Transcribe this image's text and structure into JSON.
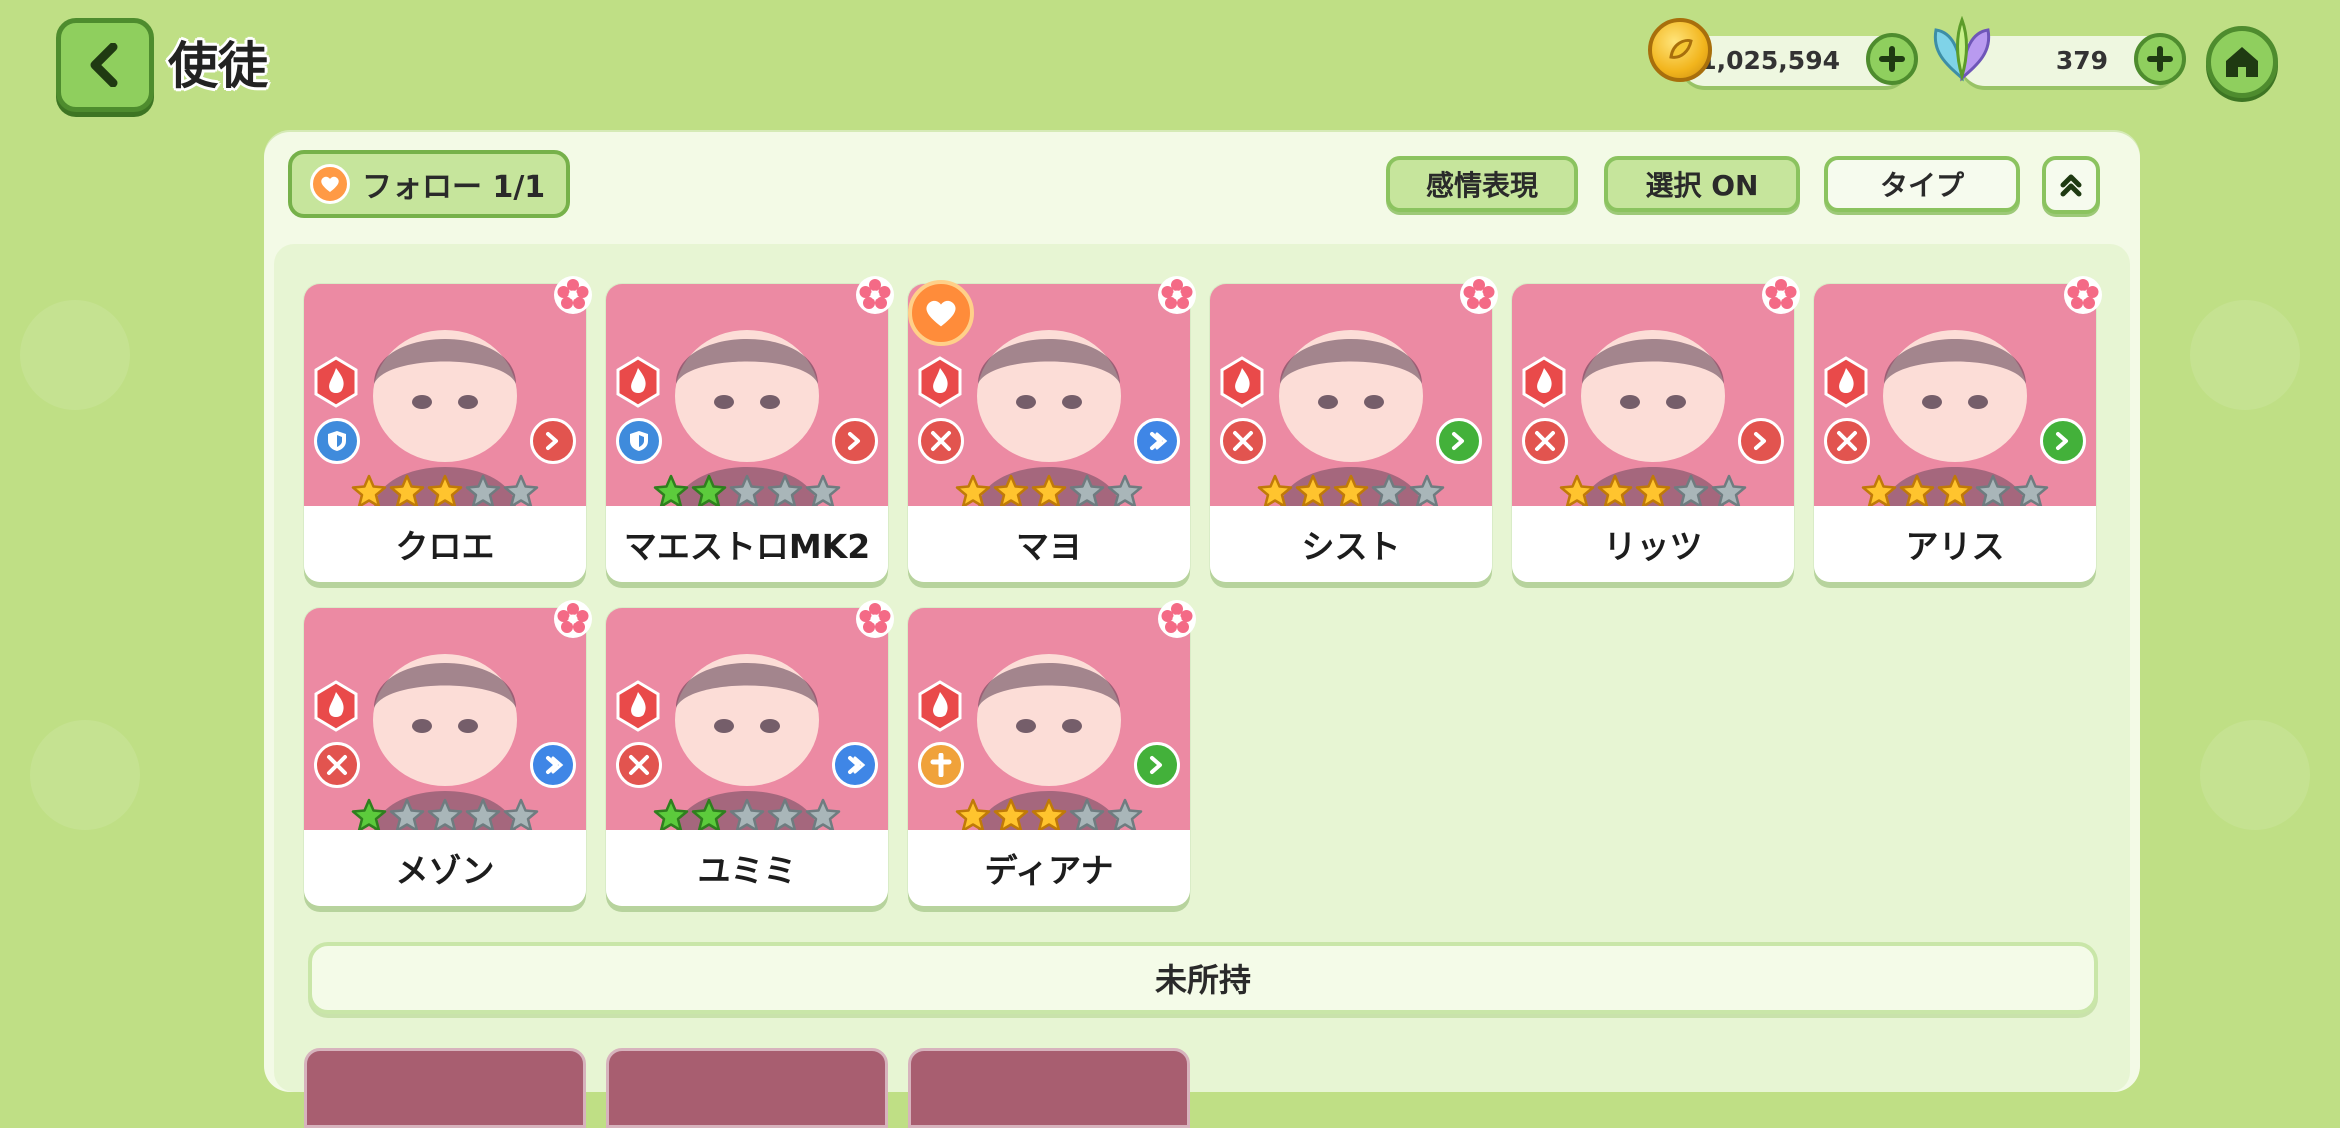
{
  "header": {
    "title": "使徒",
    "gold": "1,025,594",
    "gems": "379"
  },
  "toolbar": {
    "follow_label": "フォロー 1/1",
    "emotion_label": "感情表現",
    "select_label": "選択 ON",
    "type_label": "タイプ"
  },
  "colors": {
    "card_bg": "#ec8aa3",
    "panel_bg": "#f3fae6",
    "page_bg": "#bfdf85",
    "button_green": "#c6e59c",
    "fire_element": "#e94a4a",
    "role_defender": "#3f8bdc",
    "role_attacker": "#e2544f",
    "role_healer": "#f0a23a",
    "speed_blue": "#3f86e6",
    "speed_red": "#e2544f",
    "speed_green": "#43b13a"
  },
  "characters": [
    {
      "name": "クロエ",
      "role": "shield-icon",
      "speed": "red",
      "stars": 3,
      "star_color": "gold",
      "followed": false
    },
    {
      "name": "マエストロMK2",
      "role": "shield-icon",
      "speed": "red",
      "stars": 2,
      "star_color": "green",
      "followed": false
    },
    {
      "name": "マヨ",
      "role": "sword-icon",
      "speed": "blue",
      "stars": 3,
      "star_color": "gold",
      "followed": true
    },
    {
      "name": "シスト",
      "role": "sword-icon",
      "speed": "green",
      "stars": 3,
      "star_color": "gold",
      "followed": false
    },
    {
      "name": "リッツ",
      "role": "sword-icon",
      "speed": "red",
      "stars": 3,
      "star_color": "gold",
      "followed": false
    },
    {
      "name": "アリス",
      "role": "sword-icon",
      "speed": "green",
      "stars": 3,
      "star_color": "gold",
      "followed": false
    },
    {
      "name": "メゾン",
      "role": "sword-icon",
      "speed": "blue",
      "stars": 1,
      "star_color": "green",
      "followed": false
    },
    {
      "name": "ユミミ",
      "role": "sword-icon",
      "speed": "blue",
      "stars": 2,
      "star_color": "green",
      "followed": false
    },
    {
      "name": "ディアナ",
      "role": "cross-icon",
      "speed": "green",
      "stars": 3,
      "star_color": "gold",
      "followed": false
    }
  ],
  "unowned_label": "未所持"
}
